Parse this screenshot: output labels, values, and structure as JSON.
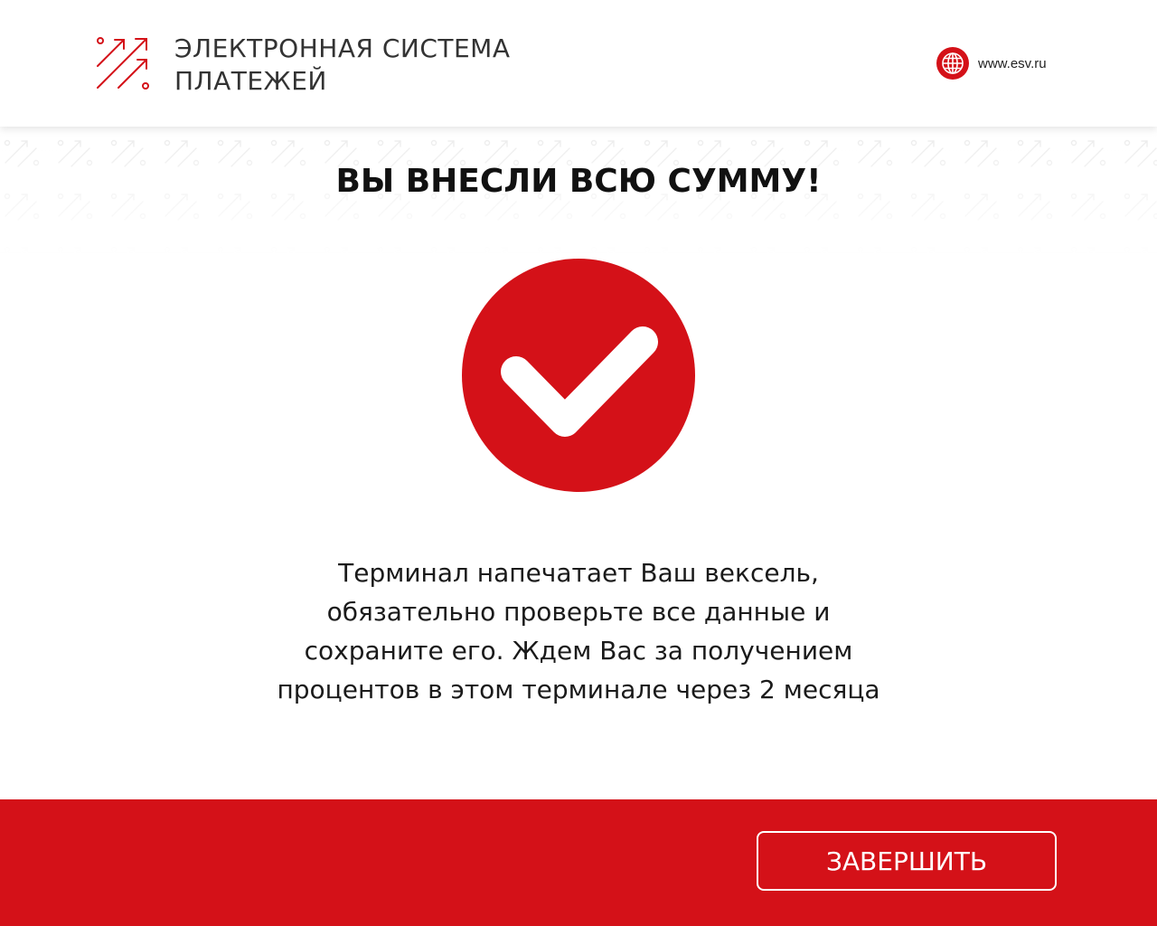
{
  "colors": {
    "brand_red": "#d41118",
    "text_dark": "#111111",
    "header_bg": "#ffffff",
    "pattern": "#e8e8e8"
  },
  "header": {
    "logo_icon": "growth-arrows-icon",
    "logo_line1": "ЭЛЕКТРОННАЯ СИСТЕМА",
    "logo_line2": "ПЛАТЕЖЕЙ",
    "site_icon": "globe-icon",
    "site_url": "www.esv.ru"
  },
  "main": {
    "title": "ВЫ ВНЕСЛИ ВСЮ СУММУ!",
    "status_icon": "checkmark-circle-icon",
    "message_lines": [
      "Терминал напечатает Ваш вексель,",
      "обязательно проверьте все данные и",
      "сохраните его. Ждем Вас за получением",
      "процентов в этом терминале через 2 месяца"
    ]
  },
  "footer": {
    "finish_label": "ЗАВЕРШИТЬ"
  }
}
